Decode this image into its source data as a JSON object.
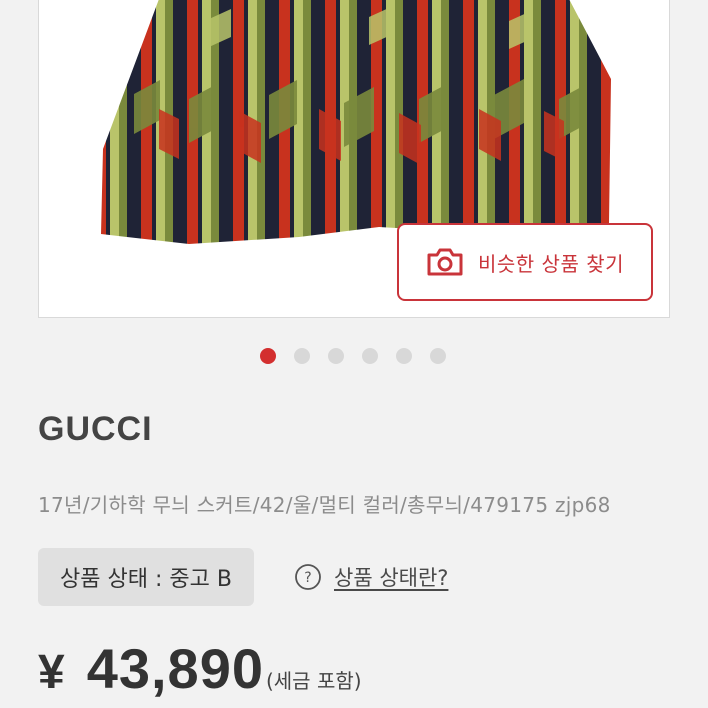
{
  "product": {
    "similar_search_label": "비슷한 상품 찾기",
    "image_count": 6,
    "active_image": 1,
    "brand": "GUCCI",
    "name": "17년/기하학 무늬 스커트/42/울/멀티 컬러/총무늬/479175 zjp68",
    "condition_label": "상품 상태 : 중고 B",
    "condition_info_label": "상품 상태란?",
    "price_currency": "¥",
    "price_amount": "43,890",
    "price_tax_note": "(세금 포함)"
  },
  "icons": {
    "camera": "camera-icon",
    "question": "question-circle-icon"
  },
  "colors": {
    "accent": "#c9343a",
    "dot_active": "#d32f2f",
    "dot_inactive": "#d8d8d8",
    "skirt_red": "#c8321e",
    "skirt_green": "#7a8a3c",
    "skirt_light_green": "#b9c46a",
    "skirt_navy": "#1f2336"
  }
}
